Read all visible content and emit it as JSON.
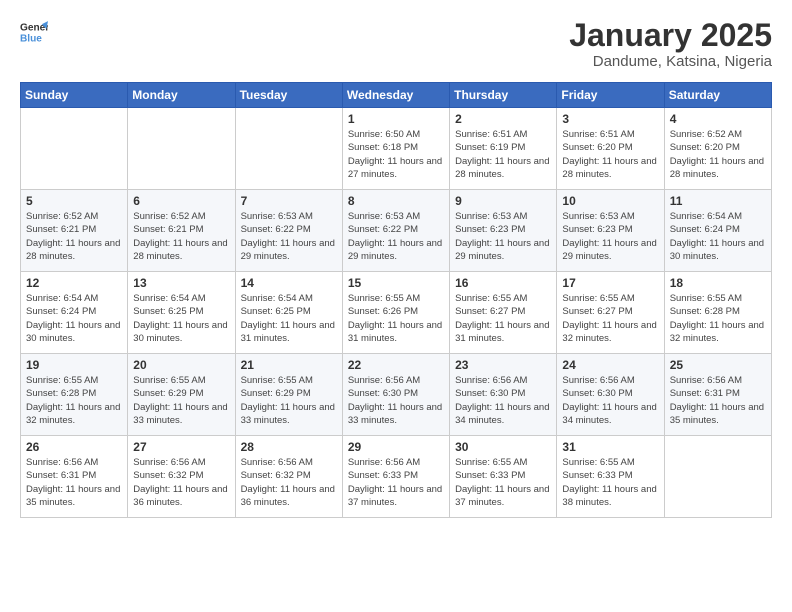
{
  "header": {
    "logo_line1": "General",
    "logo_line2": "Blue",
    "month_title": "January 2025",
    "location": "Dandume, Katsina, Nigeria"
  },
  "weekdays": [
    "Sunday",
    "Monday",
    "Tuesday",
    "Wednesday",
    "Thursday",
    "Friday",
    "Saturday"
  ],
  "weeks": [
    [
      {
        "day": "",
        "info": ""
      },
      {
        "day": "",
        "info": ""
      },
      {
        "day": "",
        "info": ""
      },
      {
        "day": "1",
        "info": "Sunrise: 6:50 AM\nSunset: 6:18 PM\nDaylight: 11 hours\nand 27 minutes."
      },
      {
        "day": "2",
        "info": "Sunrise: 6:51 AM\nSunset: 6:19 PM\nDaylight: 11 hours\nand 28 minutes."
      },
      {
        "day": "3",
        "info": "Sunrise: 6:51 AM\nSunset: 6:20 PM\nDaylight: 11 hours\nand 28 minutes."
      },
      {
        "day": "4",
        "info": "Sunrise: 6:52 AM\nSunset: 6:20 PM\nDaylight: 11 hours\nand 28 minutes."
      }
    ],
    [
      {
        "day": "5",
        "info": "Sunrise: 6:52 AM\nSunset: 6:21 PM\nDaylight: 11 hours\nand 28 minutes."
      },
      {
        "day": "6",
        "info": "Sunrise: 6:52 AM\nSunset: 6:21 PM\nDaylight: 11 hours\nand 28 minutes."
      },
      {
        "day": "7",
        "info": "Sunrise: 6:53 AM\nSunset: 6:22 PM\nDaylight: 11 hours\nand 29 minutes."
      },
      {
        "day": "8",
        "info": "Sunrise: 6:53 AM\nSunset: 6:22 PM\nDaylight: 11 hours\nand 29 minutes."
      },
      {
        "day": "9",
        "info": "Sunrise: 6:53 AM\nSunset: 6:23 PM\nDaylight: 11 hours\nand 29 minutes."
      },
      {
        "day": "10",
        "info": "Sunrise: 6:53 AM\nSunset: 6:23 PM\nDaylight: 11 hours\nand 29 minutes."
      },
      {
        "day": "11",
        "info": "Sunrise: 6:54 AM\nSunset: 6:24 PM\nDaylight: 11 hours\nand 30 minutes."
      }
    ],
    [
      {
        "day": "12",
        "info": "Sunrise: 6:54 AM\nSunset: 6:24 PM\nDaylight: 11 hours\nand 30 minutes."
      },
      {
        "day": "13",
        "info": "Sunrise: 6:54 AM\nSunset: 6:25 PM\nDaylight: 11 hours\nand 30 minutes."
      },
      {
        "day": "14",
        "info": "Sunrise: 6:54 AM\nSunset: 6:25 PM\nDaylight: 11 hours\nand 31 minutes."
      },
      {
        "day": "15",
        "info": "Sunrise: 6:55 AM\nSunset: 6:26 PM\nDaylight: 11 hours\nand 31 minutes."
      },
      {
        "day": "16",
        "info": "Sunrise: 6:55 AM\nSunset: 6:27 PM\nDaylight: 11 hours\nand 31 minutes."
      },
      {
        "day": "17",
        "info": "Sunrise: 6:55 AM\nSunset: 6:27 PM\nDaylight: 11 hours\nand 32 minutes."
      },
      {
        "day": "18",
        "info": "Sunrise: 6:55 AM\nSunset: 6:28 PM\nDaylight: 11 hours\nand 32 minutes."
      }
    ],
    [
      {
        "day": "19",
        "info": "Sunrise: 6:55 AM\nSunset: 6:28 PM\nDaylight: 11 hours\nand 32 minutes."
      },
      {
        "day": "20",
        "info": "Sunrise: 6:55 AM\nSunset: 6:29 PM\nDaylight: 11 hours\nand 33 minutes."
      },
      {
        "day": "21",
        "info": "Sunrise: 6:55 AM\nSunset: 6:29 PM\nDaylight: 11 hours\nand 33 minutes."
      },
      {
        "day": "22",
        "info": "Sunrise: 6:56 AM\nSunset: 6:30 PM\nDaylight: 11 hours\nand 33 minutes."
      },
      {
        "day": "23",
        "info": "Sunrise: 6:56 AM\nSunset: 6:30 PM\nDaylight: 11 hours\nand 34 minutes."
      },
      {
        "day": "24",
        "info": "Sunrise: 6:56 AM\nSunset: 6:30 PM\nDaylight: 11 hours\nand 34 minutes."
      },
      {
        "day": "25",
        "info": "Sunrise: 6:56 AM\nSunset: 6:31 PM\nDaylight: 11 hours\nand 35 minutes."
      }
    ],
    [
      {
        "day": "26",
        "info": "Sunrise: 6:56 AM\nSunset: 6:31 PM\nDaylight: 11 hours\nand 35 minutes."
      },
      {
        "day": "27",
        "info": "Sunrise: 6:56 AM\nSunset: 6:32 PM\nDaylight: 11 hours\nand 36 minutes."
      },
      {
        "day": "28",
        "info": "Sunrise: 6:56 AM\nSunset: 6:32 PM\nDaylight: 11 hours\nand 36 minutes."
      },
      {
        "day": "29",
        "info": "Sunrise: 6:56 AM\nSunset: 6:33 PM\nDaylight: 11 hours\nand 37 minutes."
      },
      {
        "day": "30",
        "info": "Sunrise: 6:55 AM\nSunset: 6:33 PM\nDaylight: 11 hours\nand 37 minutes."
      },
      {
        "day": "31",
        "info": "Sunrise: 6:55 AM\nSunset: 6:33 PM\nDaylight: 11 hours\nand 38 minutes."
      },
      {
        "day": "",
        "info": ""
      }
    ]
  ]
}
